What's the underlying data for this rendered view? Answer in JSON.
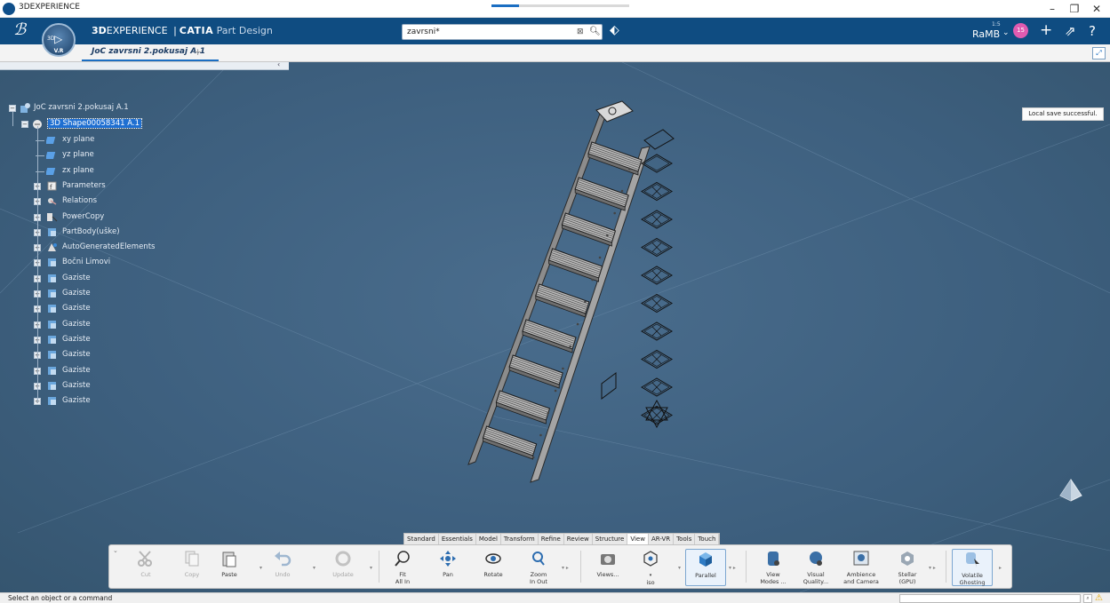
{
  "window": {
    "title": "3DEXPERIENCE"
  },
  "header": {
    "brand_3d": "3D",
    "brand_experience": "EXPERIENCE",
    "brand_sep": "|",
    "brand_app": "CATIA",
    "brand_role": "Part Design",
    "compass_version": "V.R",
    "compass_3d": "3D",
    "search_value": "zavrsni*",
    "user_name": "RaMB",
    "user_scale": "1:5",
    "avatar_badge": "15"
  },
  "doc_tab": {
    "label": "JoC zavrsni 2.pokusaj A.1",
    "add": "+"
  },
  "tree": {
    "root": "JoC zavrsni 2.pokusaj A.1",
    "shape": "3D Shape00058341 A.1",
    "items": [
      "xy plane",
      "yz plane",
      "zx plane",
      "Parameters",
      "Relations",
      "PowerCopy",
      "PartBody(uške)",
      "AutoGeneratedElements",
      "Bočni Limovi",
      "Gaziste",
      "Gaziste",
      "Gaziste",
      "Gaziste",
      "Gaziste",
      "Gaziste",
      "Gaziste",
      "Gaziste",
      "Gaziste"
    ]
  },
  "notification": "Local save successful.",
  "action_tabs": [
    "Standard",
    "Essentials",
    "Model",
    "Transform",
    "Refine",
    "Review",
    "Structure",
    "View",
    "AR-VR",
    "Tools",
    "Touch"
  ],
  "active_tab": "View",
  "commands": {
    "cut": "Cut",
    "copy": "Copy",
    "paste": "Paste",
    "undo": "Undo",
    "update": "Update",
    "fit_all_in_1": "Fit",
    "fit_all_in_2": "All In",
    "pan": "Pan",
    "rotate": "Rotate",
    "zoom_1": "Zoom",
    "zoom_2": "In Out",
    "views": "Views...",
    "iso": "iso",
    "parallel": "Parallel",
    "view_modes_1": "View",
    "view_modes_2": "Modes ...",
    "visual_quality_1": "Visual",
    "visual_quality_2": "Quality...",
    "ambience_1": "Ambience",
    "ambience_2": "and Camera",
    "stellar_1": "Stellar",
    "stellar_2": "(GPU)",
    "volatile_1": "Volatile",
    "volatile_2": "Ghosting"
  },
  "status": {
    "message": "Select an object or a command"
  },
  "colors": {
    "viewport": "#3e5f7d",
    "header": "#0f4c81",
    "selection": "#1f6fd1",
    "accent": "#1b6ec2"
  }
}
